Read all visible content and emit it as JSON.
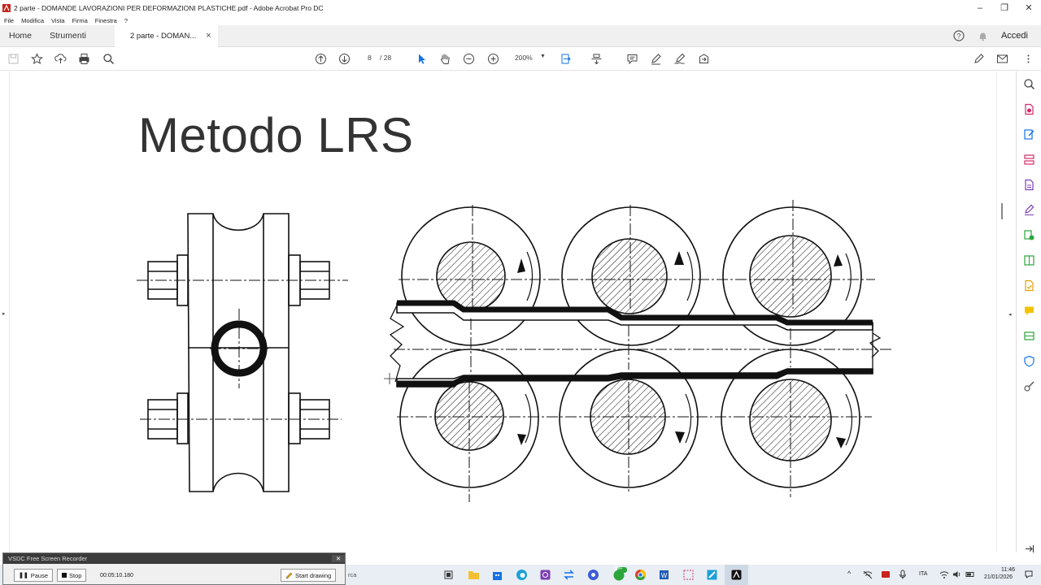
{
  "window": {
    "title": "2 parte - DOMANDE LAVORAZIONI PER DEFORMAZIONI PLASTICHE.pdf - Adobe Acrobat Pro DC"
  },
  "menu": [
    "File",
    "Modifica",
    "Vista",
    "Firma",
    "Finestra",
    "?"
  ],
  "tabs": {
    "home": "Home",
    "tools": "Strumenti",
    "document": "2 parte - DOMAN...",
    "signin": "Accedi"
  },
  "toolbar": {
    "page_current": "8",
    "page_total": "/ 28",
    "zoom": "200%"
  },
  "slide": {
    "title": "Metodo LRS"
  },
  "recorder": {
    "title": "VSDC Free Screen Recorder",
    "pause": "Pause",
    "stop": "Stop",
    "elapsed": "00:05:10.180",
    "start_drawing": "Start drawing"
  },
  "taskbar": {
    "search_fragment": "rca",
    "language": "ITA",
    "time": "11:46",
    "date": "21/01/2026",
    "badge": "99+"
  },
  "colors": {
    "acrobat_red": "#c8231c",
    "toolbar_blue": "#1473e6",
    "sidebar_green": "#2ba53c",
    "sidebar_purple": "#7b3fb2",
    "sidebar_pink": "#d42a6c"
  }
}
